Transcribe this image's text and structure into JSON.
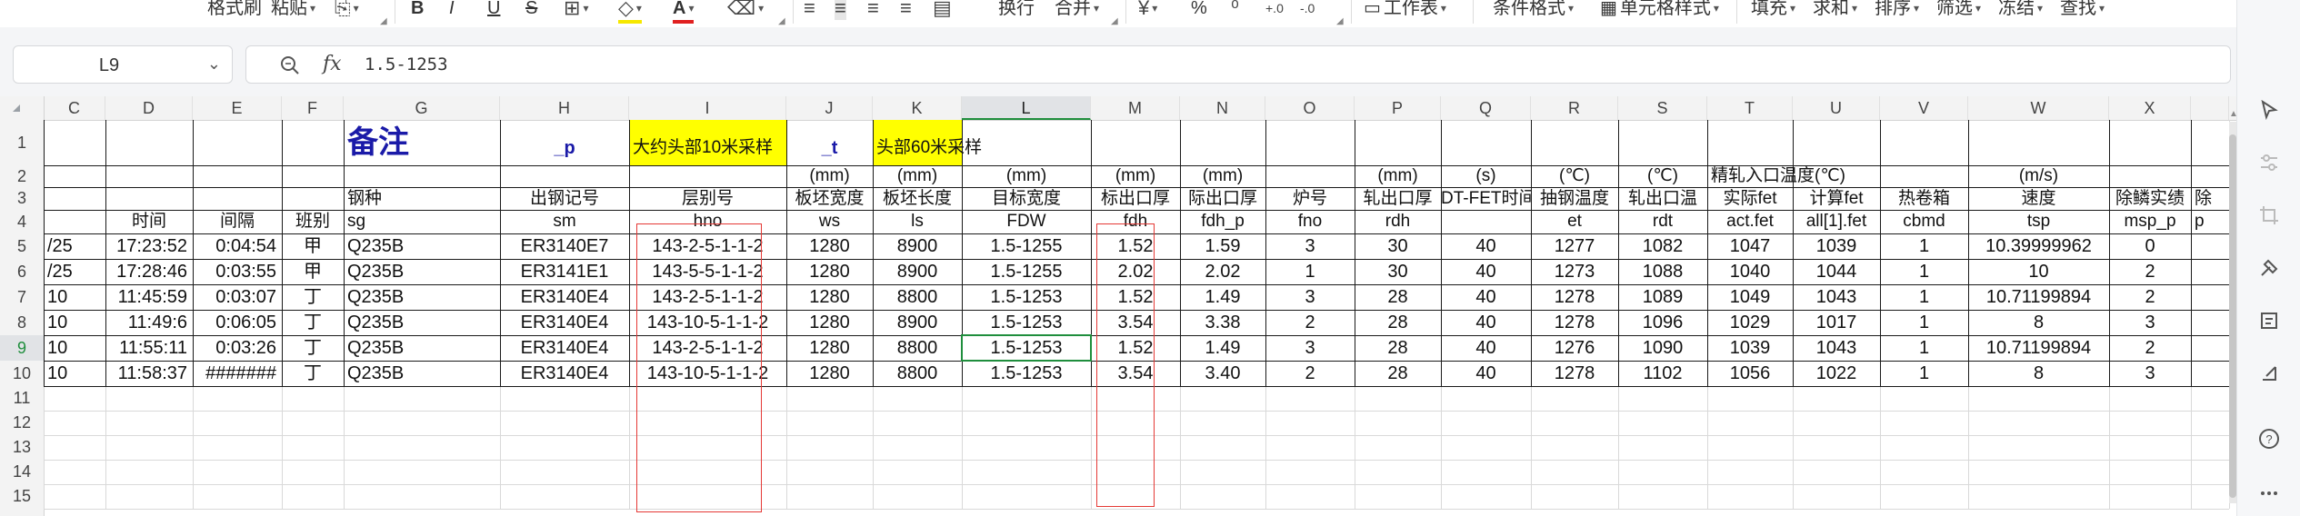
{
  "ribbon": {
    "format_painter": "格式刷",
    "paste": "粘贴",
    "bold": "B",
    "italic": "I",
    "underline": "U",
    "strike": "S",
    "font_color_glyph": "A",
    "wrap": "换行",
    "merge": "合并",
    "percent": "%",
    "worksheet": "工作表",
    "conditional_format": "条件格式",
    "cell_style": "单元格样式",
    "fill": "填充",
    "sum": "求和",
    "sort": "排序",
    "filter": "筛选",
    "freeze": "冻结",
    "find": "查找"
  },
  "formula_bar": {
    "cell_ref": "L9",
    "fx": "fx",
    "value": "1.5-1253"
  },
  "columns": [
    "C",
    "D",
    "E",
    "F",
    "G",
    "H",
    "I",
    "J",
    "K",
    "L",
    "M",
    "N",
    "O",
    "P",
    "Q",
    "R",
    "S",
    "T",
    "U",
    "V",
    "W",
    "X"
  ],
  "active_column": "L",
  "active_row": "9",
  "row_numbers": [
    "1",
    "2",
    "3",
    "4",
    "5",
    "6",
    "7",
    "8",
    "9",
    "10",
    "11",
    "12",
    "13",
    "14",
    "15"
  ],
  "header_rows": {
    "r1": {
      "G": "备注",
      "H": "_p",
      "I": "大约头部10米采样",
      "J": "_t",
      "K": "头部60米采样"
    },
    "r2": {
      "J": "(mm)",
      "K": "(mm)",
      "L": "(mm)",
      "M": "(mm)",
      "N": "(mm)",
      "P": "(mm)",
      "Q": "(s)",
      "R": "(℃)",
      "S": "(℃)",
      "T": "精轧入口温度(℃)",
      "W": "(m/s)"
    },
    "r3": {
      "G": "钢种",
      "H": "出钢记号",
      "I": "层别号",
      "J": "板坯宽度",
      "K": "板坯长度",
      "L": "目标宽度",
      "M": "标出口厚",
      "N": "际出口厚",
      "O": "炉号",
      "P": "轧出口厚",
      "Q": "DT-FET时间",
      "R": "抽钢温度",
      "S": "轧出口温",
      "T": "实际fet",
      "U": "计算fet",
      "V": "热卷箱",
      "W": "速度",
      "X": "除鳞实绩",
      "Y": "除"
    },
    "r4": {
      "D": "时间",
      "E": "间隔",
      "F": "班别",
      "G": "sg",
      "H": "sm",
      "I": "hno",
      "J": "ws",
      "K": "ls",
      "L": "FDW",
      "M": "fdh",
      "N": "fdh_p",
      "O": "fno",
      "P": "rdh",
      "R": "et",
      "S": "rdt",
      "T": "act.fet",
      "U": "all[1].fet",
      "V": "cbmd",
      "W": "tsp",
      "X": "msp_p",
      "Y": "p"
    }
  },
  "data_rows": [
    {
      "C": "/25",
      "D": "17:23:52",
      "E": "0:04:54",
      "F": "甲",
      "G": "Q235B",
      "H": "ER3140E7",
      "I": "143-2-5-1-1-2",
      "J": "1280",
      "K": "8900",
      "L": "1.5-1255",
      "M": "1.52",
      "N": "1.59",
      "O": "3",
      "P": "30",
      "Q": "40",
      "R": "1277",
      "S": "1082",
      "T": "1047",
      "U": "1039",
      "V": "1",
      "W": "10.39999962",
      "X": "0"
    },
    {
      "C": "/25",
      "D": "17:28:46",
      "E": "0:03:55",
      "F": "甲",
      "G": "Q235B",
      "H": "ER3141E1",
      "I": "143-5-5-1-1-2",
      "J": "1280",
      "K": "8900",
      "L": "1.5-1255",
      "M": "2.02",
      "N": "2.02",
      "O": "1",
      "P": "30",
      "Q": "40",
      "R": "1273",
      "S": "1088",
      "T": "1040",
      "U": "1044",
      "V": "1",
      "W": "10",
      "X": "2"
    },
    {
      "C": "10",
      "D": "11:45:59",
      "E": "0:03:07",
      "F": "丁",
      "G": "Q235B",
      "H": "ER3140E4",
      "I": "143-2-5-1-1-2",
      "J": "1280",
      "K": "8800",
      "L": "1.5-1253",
      "M": "1.52",
      "N": "1.49",
      "O": "3",
      "P": "28",
      "Q": "40",
      "R": "1278",
      "S": "1089",
      "T": "1049",
      "U": "1043",
      "V": "1",
      "W": "10.71199894",
      "X": "2"
    },
    {
      "C": "10",
      "D": "11:49:6",
      "E": "0:06:05",
      "F": "丁",
      "G": "Q235B",
      "H": "ER3140E4",
      "I": "143-10-5-1-1-2",
      "J": "1280",
      "K": "8900",
      "L": "1.5-1253",
      "M": "3.54",
      "N": "3.38",
      "O": "2",
      "P": "28",
      "Q": "40",
      "R": "1278",
      "S": "1096",
      "T": "1029",
      "U": "1017",
      "V": "1",
      "W": "8",
      "X": "3"
    },
    {
      "C": "10",
      "D": "11:55:11",
      "E": "0:03:26",
      "F": "丁",
      "G": "Q235B",
      "H": "ER3140E4",
      "I": "143-2-5-1-1-2",
      "J": "1280",
      "K": "8800",
      "L": "1.5-1253",
      "M": "1.52",
      "N": "1.49",
      "O": "3",
      "P": "28",
      "Q": "40",
      "R": "1276",
      "S": "1090",
      "T": "1039",
      "U": "1043",
      "V": "1",
      "W": "10.71199894",
      "X": "2"
    },
    {
      "C": "10",
      "D": "11:58:37",
      "E": "#######",
      "F": "丁",
      "G": "Q235B",
      "H": "ER3140E4",
      "I": "143-10-5-1-1-2",
      "J": "1280",
      "K": "8800",
      "L": "1.5-1253",
      "M": "3.54",
      "N": "3.40",
      "O": "2",
      "P": "28",
      "Q": "40",
      "R": "1278",
      "S": "1102",
      "T": "1056",
      "U": "1022",
      "V": "1",
      "W": "8",
      "X": "3"
    }
  ],
  "colors": {
    "highlight_yellow": "#ffff00",
    "red_box": "#e53935",
    "selection_green": "#1f8e3d",
    "note_blue": "#1a1aa8"
  },
  "icons": [
    "format-painter-icon",
    "paste-icon",
    "copy-icon",
    "font-color-icon",
    "fill-color-icon",
    "eraser-icon",
    "align-left-icon",
    "align-center-icon",
    "align-right-icon",
    "justify-icon",
    "distributed-icon",
    "wrap-icon",
    "merge-icon",
    "currency-icon",
    "percent-icon",
    "thousands-icon",
    "increase-decimal-icon",
    "decrease-decimal-icon",
    "worksheet-icon",
    "zoom-icon",
    "fx-icon",
    "select-arrow-icon",
    "filter-panel-icon",
    "crop-icon",
    "tools-icon",
    "property-icon",
    "help-icon",
    "more-icon"
  ]
}
